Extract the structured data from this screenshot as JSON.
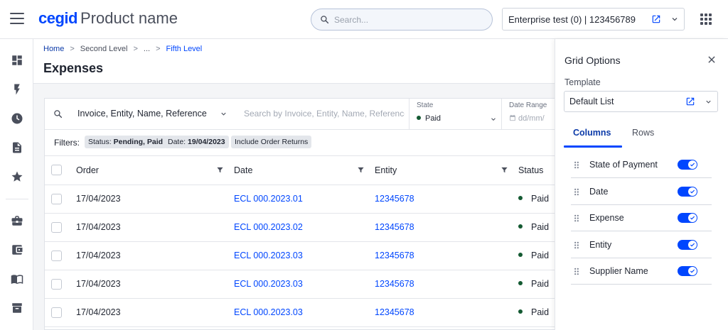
{
  "app": {
    "brand": "cegid",
    "product_name": "Product name"
  },
  "search": {
    "placeholder": "Search..."
  },
  "enterprise": {
    "label": "Enterprise test (0) | 123456789"
  },
  "breadcrumb": {
    "home": "Home",
    "second": "Second Level",
    "ellipsis": "...",
    "current": "Fifth Level"
  },
  "page": {
    "title": "Expenses"
  },
  "toolbar": {
    "scope": "Invoice, Entity, Name, Reference",
    "search_placeholder": "Search by Invoice, Entity, Name, Reference...",
    "state": {
      "label": "State",
      "value": "Paid"
    },
    "date_range": {
      "label": "Date Range",
      "placeholder": "dd/mm/"
    }
  },
  "filters": {
    "label": "Filters:",
    "chips": [
      {
        "key": "Status:",
        "value": "Pending, Paid"
      },
      {
        "key": "Date:",
        "value": "19/04/2023"
      },
      {
        "key": "",
        "value": "Include Order Returns"
      }
    ]
  },
  "table": {
    "columns": [
      "Order",
      "Date",
      "Entity",
      "Status"
    ],
    "rows": [
      {
        "order": "17/04/2023",
        "date": "ECL 000.2023.01",
        "entity": "12345678",
        "status": "Paid"
      },
      {
        "order": "17/04/2023",
        "date": "ECL 000.2023.02",
        "entity": "12345678",
        "status": "Paid"
      },
      {
        "order": "17/04/2023",
        "date": "ECL 000.2023.03",
        "entity": "12345678",
        "status": "Paid"
      },
      {
        "order": "17/04/2023",
        "date": "ECL 000.2023.03",
        "entity": "12345678",
        "status": "Paid"
      },
      {
        "order": "17/04/2023",
        "date": "ECL 000.2023.03",
        "entity": "12345678",
        "status": "Paid"
      }
    ]
  },
  "grid_options": {
    "title": "Grid Options",
    "template_label": "Template",
    "template_value": "Default List",
    "tabs": [
      "Columns",
      "Rows"
    ],
    "columns": [
      {
        "name": "State of Payment",
        "enabled": true
      },
      {
        "name": "Date",
        "enabled": true
      },
      {
        "name": "Expense",
        "enabled": true
      },
      {
        "name": "Entity",
        "enabled": true
      },
      {
        "name": "Supplier Name",
        "enabled": true
      }
    ]
  },
  "colors": {
    "brand": "#0046fe",
    "paid": "#145a32",
    "link": "#0046fe"
  },
  "icons": [
    "menu-icon",
    "search-icon",
    "external-link-icon",
    "chevron-down-icon",
    "apps-grid-icon",
    "dashboard-icon",
    "bolt-icon",
    "clock-icon",
    "document-icon",
    "star-icon",
    "briefcase-icon",
    "wallet-icon",
    "book-icon",
    "archive-icon",
    "filter-icon",
    "close-icon",
    "drag-handle-icon",
    "check-icon",
    "calendar-icon"
  ]
}
